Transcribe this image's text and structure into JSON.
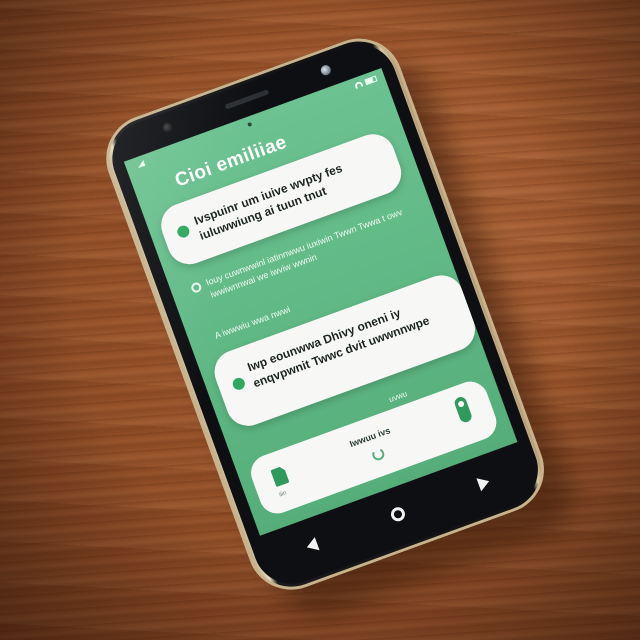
{
  "status_bar": {
    "time": "",
    "icons": [
      "signal-icon",
      "wifi-icon",
      "battery-icon"
    ]
  },
  "app": {
    "title": "Cioi emiliiae"
  },
  "cards": [
    {
      "text": "Ivspuinr um iuive wvpty fes iuluwwiung ai tuun tnut"
    },
    {
      "text": "Iwp eounwwa Dhivy oneni iy enqvpwnit Twwc dvit uwwnnwpe"
    }
  ],
  "info": {
    "text": "Iouy cuwnwwinl iatinnwwu iuxiwin Twwn Twwa t owv iwwiwnnwai we iwviw wwnin"
  },
  "small_label": "A iwwwiu wwa nwwi",
  "mid_label": "uvwu",
  "bottom_panel": {
    "label": "Iwwuu ivs",
    "doc_caption": "iiin"
  },
  "nav": {
    "back": "back-icon",
    "home": "home-icon",
    "recents": "recents-icon"
  },
  "colors": {
    "screen_green": "#5eb783",
    "accent_green": "#2fa861",
    "card_bg": "#f7f8f6"
  }
}
